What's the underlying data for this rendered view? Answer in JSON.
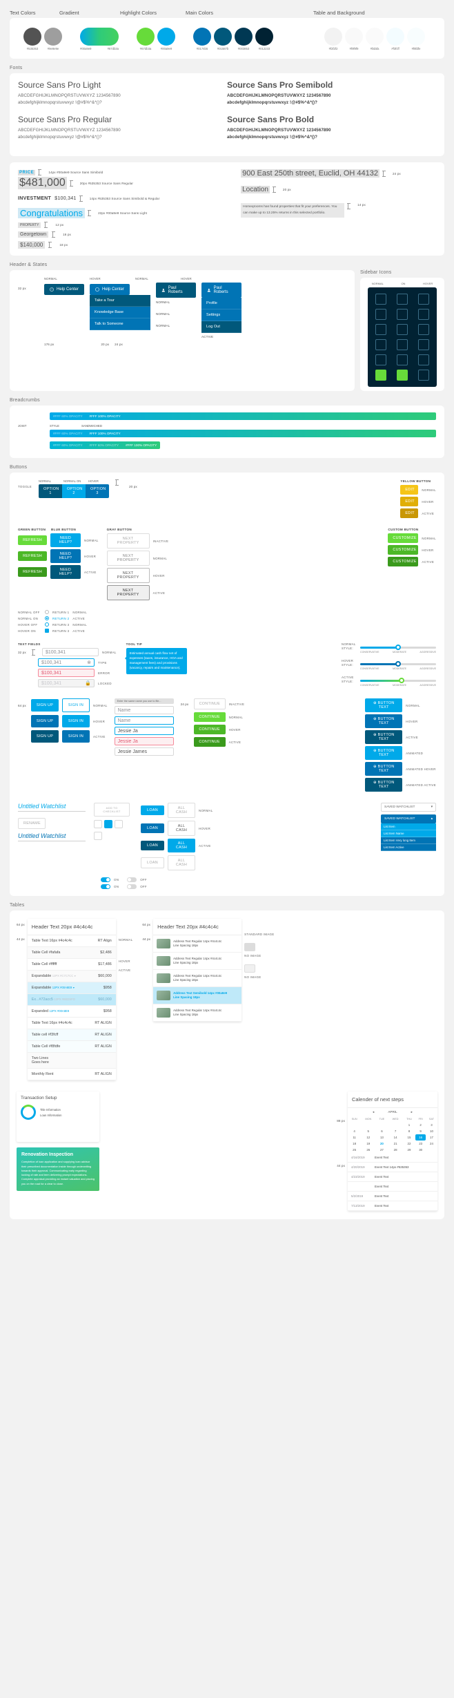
{
  "palette": {
    "groups": [
      {
        "label": "Text Colors",
        "swatches": [
          {
            "hex": "#535353",
            "name": "text-dark"
          },
          {
            "hex": "#9e9e9e",
            "name": "text-gray"
          }
        ]
      },
      {
        "label": "Gradient",
        "swatches": [
          {
            "hex": "#00a9e9",
            "name": "gradient-start",
            "hex2": "#67db3a",
            "wide": true,
            "hexLabels": [
              "#00a9e9",
              "#67db3a"
            ]
          }
        ]
      },
      {
        "label": "Highlight Colors",
        "swatches": [
          {
            "hex": "#67db3a",
            "name": "highlight-green"
          },
          {
            "hex": "#00a9e9",
            "name": "highlight-blue"
          }
        ]
      },
      {
        "label": "Main Colors",
        "swatches": [
          {
            "hex": "#0174b5",
            "name": "main-blue"
          },
          {
            "hex": "#01587b",
            "name": "main-blue-dark"
          },
          {
            "hex": "#003853",
            "name": "main-navy"
          },
          {
            "hex": "#012233",
            "name": "main-navy-dark"
          }
        ]
      },
      {
        "label": "Table and Background",
        "swatches": [
          {
            "hex": "#f2f2f2",
            "name": "bg-1"
          },
          {
            "hex": "#f9f9f9",
            "name": "bg-2"
          },
          {
            "hex": "#fafafa",
            "name": "bg-3"
          },
          {
            "hex": "#f3fcff",
            "name": "bg-4"
          },
          {
            "hex": "#f8fdfe",
            "name": "bg-5"
          }
        ]
      }
    ]
  },
  "fonts": {
    "label": "Fonts",
    "specimens": [
      {
        "name": "Source Sans Pro Light",
        "weight": "light",
        "upper": "ABCDEFGHIJKLMNOPQRSTUVWXYZ 1234567890",
        "lower": "abcdefghijklmnopqrstuvwxyz !@#$%^&*()?"
      },
      {
        "name": "Source Sans Pro Semibold",
        "weight": "semi",
        "upper": "ABCDEFGHIJKLMNOPQRSTUVWXYZ 1234567890",
        "lower": "abcdefghijklmnopqrstuvwxyz !@#$%^&*()?"
      },
      {
        "name": "Source Sans Pro Regular",
        "weight": "reg",
        "upper": "ABCDEFGHIJKLMNOPQRSTUVWXYZ 1234567890",
        "lower": "abcdefghijklmnopqrstuvwxyz !@#$%^&*()?"
      },
      {
        "name": "Source Sans Pro Bold",
        "weight": "bold",
        "upper": "ABCDEFGHIJKLMNOPQRSTUVWXYZ 1234567890",
        "lower": "abcdefghijklmnopqrstuvwxyz !@#$%^&*()?"
      }
    ]
  },
  "typography": {
    "price_label": "PRICE",
    "price_label_spec": "14px #00a9e9 Source Sans Simibold",
    "price_value": "$481,000",
    "price_value_spec": "20px #535353 Source Sans Regular",
    "investment_label": "INVESTMENT",
    "investment_value": "$100,341",
    "investment_spec": "14px #535353 Source Sans Simibold & Regular",
    "congrats": "Congratulations",
    "congrats_spec": "22px #00a9e9 Source Sans Light",
    "mini_rows": [
      {
        "k": "PROPERTY",
        "v": "12 px"
      },
      {
        "k": "Georgetown",
        "v": "16 px"
      },
      {
        "k": "$140,000",
        "v": "18 px"
      }
    ],
    "address": "900 East 250th street, Euclid, OH 44132",
    "address_spec": "24 px",
    "location": "Location",
    "location_spec": "20 px",
    "para": "Homeqrooms has found properties that fit your preferences. You can make up to 13.25% returns in this selected portfolio.",
    "para_spec": "14 px"
  },
  "header_states": {
    "label": "Header & States",
    "col_normal": "NORMAL",
    "col_hover": "HOVER",
    "col_active": "ACTIVE",
    "help_center": "Help Center",
    "user_name": "Paul Roberts",
    "menu_items": [
      "Take a Tour",
      "Knowledge Base",
      "Talk to Someone"
    ],
    "user_menu": [
      "Profile",
      "Settings",
      "Log Out"
    ],
    "dims": [
      "32 px",
      "176 px",
      "20 px",
      "24 px"
    ]
  },
  "sidebar_icons": {
    "label": "Sidebar Icons",
    "cols": [
      "NORMAL",
      "ON",
      "HOVER"
    ]
  },
  "breadcrumbs": {
    "label": "Breadcrumbs",
    "rows": [
      {
        "left": "#FFF 60% OPACITY",
        "right": "#FFF 100% OPACITY",
        "leftlabel": ""
      },
      {
        "left": "#FFF 60% OPACITY",
        "right": "#FFF 100% OPACITY",
        "leftlabel": "JOIST"
      },
      {
        "left": "#FFF 60% OPACITY",
        "right": "#FFF 100% OPACITY",
        "leftlabel": "STYLE"
      }
    ],
    "steps_top": [
      "#FFF 60% OPACITY",
      "#FFF 100% OPACITY"
    ],
    "steps_mid_labels": [
      "JOIST",
      "STYLE",
      "SANDWICHED"
    ],
    "steps_bot": [
      "#FFF 60% OPACITY",
      "#FFF 60% OPACITY",
      "#FFF 100% OPACITY"
    ]
  },
  "buttons": {
    "label": "Buttons",
    "toggle_label": "TOGGLE",
    "toggle_states": [
      "NORMAL",
      "NORMAL ON",
      "HOVER"
    ],
    "toggle_options": [
      "OPTION 1",
      "OPTION 2",
      "OPTION 3"
    ],
    "toggle_dim": "20 px",
    "yellow_title": "YELLOW BUTTON",
    "yellow_label": "EDIT",
    "yellow_states": [
      "NORMAL",
      "HOVER",
      "ACTIVE"
    ],
    "green_title": "GREEN BUTTON",
    "blue_title": "BLUE BUTTON",
    "green_label": "REFRESH",
    "blue_label": "NEED HELP?",
    "state_rows": [
      "NORMAL",
      "HOVER",
      "ACTIVE"
    ],
    "gray_title": "GRAY BUTTON",
    "gray_label": "NEXT PROPERTY",
    "gray_states": [
      "INACTIVE",
      "NORMAL",
      "HOVER",
      "ACTIVE"
    ],
    "custom_title": "CUSTOM BUTTON",
    "custom_label": "CUSTOMIZE",
    "radio_labels": [
      "NORMAL OFF",
      "NORMAL ON",
      "HOVER OFF",
      "HOVER ON"
    ],
    "radio_opts": [
      "RETURN 1",
      "RETURN 2",
      "RETURN 3"
    ],
    "check_labels": [
      "NORMAL",
      "ACTIVE",
      "NORMAL",
      "ACTIVE"
    ],
    "textfields_title": "TEXT FIELDS",
    "textfield_value": "$100,341",
    "textfield_states": [
      "NORMAL",
      "TYPE",
      "ERROR",
      "LOCKED"
    ],
    "textfield_dim": "32 px",
    "tooltip_title": "TOOL TIP",
    "tooltip_text": "Estimated annual cash flow net of expenses (taxes, insurance, HOA and management fees) and provisions (vacancy, repairs and maintenance).",
    "slider_title": "STYLE:",
    "slider_ticks": [
      "CONSERVATIVE",
      "MODERATE",
      "AGGRESSIVE"
    ],
    "slider_states": [
      "NORMAL",
      "HOVER",
      "ACTIVE"
    ],
    "signup": "SIGN UP",
    "signin": "SIGN IN",
    "cta_states": [
      "NORMAL",
      "HOVER",
      "ACTIVE"
    ],
    "name_placeholder": "Name",
    "name_tooltip": "Enter the same name you use to file...",
    "name_value": "Jessie Ja",
    "name_value_done": "Jessie James",
    "continue_label": "CONTINUE",
    "continue_states": [
      "INACTIVE",
      "NORMAL",
      "HOVER",
      "ACTIVE"
    ],
    "button_text": "BUTTON TEXT",
    "button_text_states": [
      "NORMAL",
      "HOVER",
      "ACTIVE",
      "ANIMATED",
      "ANIMATED HOVER",
      "ANIMATED ACTIVE"
    ],
    "watchlist_untitled": "Untitled Watchlist",
    "watchlist_rename": "RENAME",
    "add_checklist": "ADD TO CHECKLIST",
    "loan_label": "LOAN",
    "allcash_label": "ALL CASH",
    "saved_watchlist": "SAVED WATCHLIST",
    "watchlist_items": [
      "List Item",
      "List Item Name",
      "List Item Very long Item",
      "List Item Active"
    ],
    "switch_labels": [
      "ON",
      "OFF",
      "ON",
      "OFF"
    ]
  },
  "tables": {
    "label": "Tables",
    "header": "Header Text 20px #4c4c4c",
    "rows": [
      {
        "c1": "Table Text 16px #4c4c4c",
        "c2": "RT Align",
        "style": ""
      },
      {
        "c1": "Table Cell #fafafa",
        "c2": "$2,486",
        "style": "alt"
      },
      {
        "c1": "Table Cell #ffffff",
        "c2": "$17,486",
        "style": ""
      },
      {
        "c1": "Expandable",
        "sub": "12PX #C7C7CC",
        "c2": "$60,000",
        "style": "alt"
      },
      {
        "c1": "Expandable",
        "sub": "12PX #00A8E9",
        "c2": "$958",
        "style": "sel"
      },
      {
        "c1": "Ex...#72acc5",
        "sub": "12PX #6EDSFO",
        "c2": "$60,000",
        "style": "sel2"
      },
      {
        "c1": "Expanded",
        "sub": "12PX #00A8E9",
        "c2": "$958",
        "style": ""
      },
      {
        "c1": "Table Text 16px #4c4c4c",
        "c2": "RT ALIGN",
        "style": ""
      },
      {
        "c1": "Table cell #f3fcff",
        "c2": "RT ALIGN",
        "style": "alt"
      },
      {
        "c1": "Table Cell #f8fdfe",
        "c2": "RT ALIGN",
        "style": ""
      },
      {
        "c1": "Two Lines\nGoes here",
        "c2": "",
        "style": "alt"
      },
      {
        "c1": "Monthly Rent",
        "c2": "RT ALIGN",
        "style": ""
      }
    ],
    "dims": [
      "64 px",
      "44 px",
      "88 px",
      "44 px",
      "24 px",
      "48 px"
    ],
    "row_states": [
      "NORMAL",
      "HOVER",
      "ACTIVE"
    ],
    "listrows": [
      {
        "t": "Address Text Regular 14px #4c4c4c\nLine Spacing 18px",
        "sel": false
      },
      {
        "t": "Address Text Regular 14px #4c4c4c\nLine Spacing 18px",
        "sel": false
      },
      {
        "t": "Address Text Regular 14px #4c4c4c\nLine Spacing 18px",
        "sel": false
      },
      {
        "t": "Address Text Semibold 14px #00a9e9\nLine Spacing 18px",
        "sel": true
      },
      {
        "t": "Address Text Regular 14px #4c4c4c\nLine Spacing 18px",
        "sel": false
      }
    ],
    "image_labels": [
      "STANDARD IMAGE",
      "NO IMAGE",
      "NO IMAGE"
    ],
    "calendar": {
      "title": "Calender of next steps",
      "month": "APRIL",
      "year": "",
      "dow": [
        "SUN",
        "MON",
        "TUE",
        "WED",
        "THU",
        "FRI",
        "SAT"
      ],
      "weeks": [
        [
          "",
          "",
          "",
          "",
          "1",
          "2",
          "3"
        ],
        [
          "4",
          "5",
          "6",
          "7",
          "8",
          "9",
          "10"
        ],
        [
          "11",
          "12",
          "13",
          "14",
          "15",
          "16",
          "17"
        ],
        [
          "18",
          "19",
          "20",
          "21",
          "22",
          "23",
          "24"
        ],
        [
          "25",
          "26",
          "27",
          "28",
          "29",
          "30",
          ""
        ]
      ],
      "highlight": [
        "16"
      ],
      "bold": [
        "20"
      ],
      "events": [
        {
          "d": "4/16/2019",
          "t": "Event Text"
        },
        {
          "d": "4/20/2019",
          "t": "Event Text 14px #535353"
        },
        {
          "d": "4/23/2019",
          "t": "Event Text"
        },
        {
          "d": "",
          "t": "Event Text"
        },
        {
          "d": "5/2/2019",
          "t": "Event Text"
        },
        {
          "d": "7/13/2019",
          "t": "Event Text"
        }
      ]
    },
    "transaction": {
      "title": "Transaction Setup",
      "items": [
        "Title Information",
        "Loan Information"
      ]
    },
    "renovation": {
      "title": "Renovation Inspection",
      "body": "Completion of loan application and supplying loan advisor their prescribed documentation inside through underwriting towards their approval. Communicating early regarding locking of rate and term delivering prompt expectations. Complete appraisal providing an instant valuation and placing you on the road for a clear to close."
    }
  }
}
